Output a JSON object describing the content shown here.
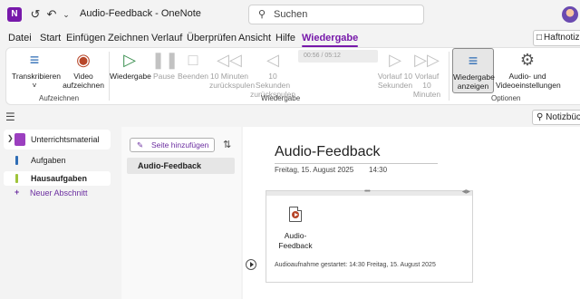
{
  "titlebar": {
    "app_icon": "onenote-logo",
    "logo_letter": "N",
    "back_icon": "back-arrow-circle-icon",
    "undo_icon": "undo-icon",
    "more_icon": "chevron-down-icon",
    "title": "Audio-Feedback - OneNote",
    "search_placeholder": "Suchen"
  },
  "menu": {
    "tabs": [
      "Datei",
      "Start",
      "Einfügen",
      "Zeichnen",
      "Verlauf",
      "Überprüfen",
      "Ansicht",
      "Hilfe",
      "Wiedergabe"
    ],
    "active_tab": "Wiedergabe",
    "haftnotizen_label": "Haftnotize"
  },
  "ribbon": {
    "time_display": "00:56 / 05:12",
    "buttons": {
      "transcribe": "Transkribieren",
      "video_record": "Video aufzeichnen",
      "playback": "Wiedergabe",
      "pause": "Pause",
      "stop": "Beenden",
      "rewind10min": "10 Minuten zurückspulen",
      "rewind10sec": "10 Sekunden zurückspulen",
      "forward10sec": "Vorlauf 10 Sekunden",
      "forward10min": "Vorlauf 10 Minuten",
      "see_playback": "Wiedergabe anzeigen",
      "av_settings": "Audio- und Videoeinstellungen"
    },
    "groups": {
      "record": "Aufzeichnen",
      "playback": "Wiedergabe",
      "options": "Optionen"
    }
  },
  "navrow": {
    "notebooks_label": "Notizbüch"
  },
  "sections": {
    "notebook_name": "Unterrichtsmaterial",
    "items": [
      {
        "label": "Aufgaben",
        "color": "#2f6db5",
        "active": false
      },
      {
        "label": "Hausaufgaben",
        "color": "#9fc43a",
        "active": true
      }
    ],
    "add_section": "Neuer Abschnitt"
  },
  "pages": {
    "add_page": "Seite hinzufügen",
    "items": [
      {
        "label": "Audio-Feedback"
      }
    ]
  },
  "canvas": {
    "page_title": "Audio-Feedback",
    "date": "Freitag, 15. August 2025",
    "time": "14:30",
    "audio_label": "Audio-Feedback",
    "recording_started": "Audioaufnahme gestartet: 14:30 Freitag, 15. August 2025"
  },
  "colors": {
    "accent": "#7719aa",
    "ribbon_icon": "#2d6cb5"
  }
}
